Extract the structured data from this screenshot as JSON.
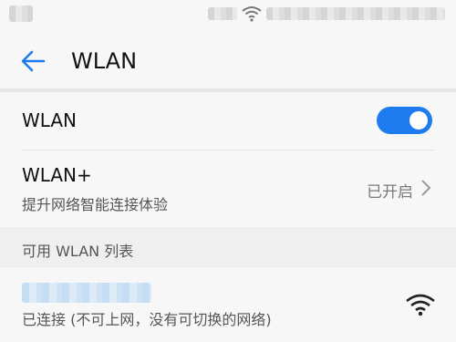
{
  "title": "WLAN",
  "wlan_row": {
    "label": "WLAN",
    "enabled": true
  },
  "wlan_plus": {
    "label": "WLAN+",
    "subtitle": "提升网络智能连接体验",
    "status": "已开启"
  },
  "available_section": {
    "label": "可用 WLAN 列表"
  },
  "network": {
    "status_text": "已连接 (不可上网，没有可切换的网络)"
  },
  "colors": {
    "accent": "#1f7cf0",
    "background": "#f7f7f7"
  },
  "icons": {
    "back": "arrow-left-icon",
    "chevron": "chevron-right-icon",
    "wifi": "wifi-signal-icon"
  }
}
